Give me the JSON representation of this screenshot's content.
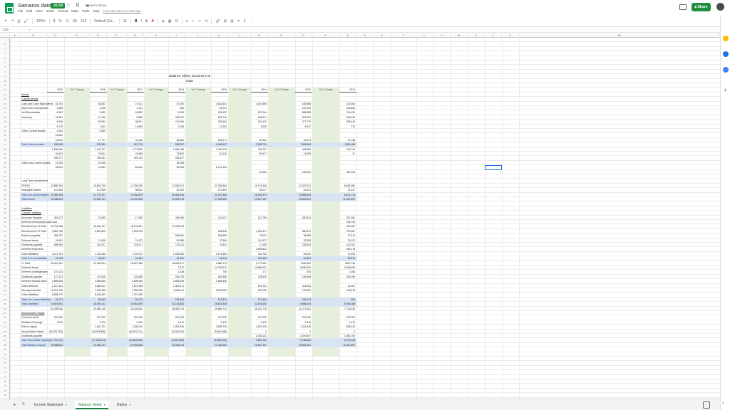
{
  "app": {
    "doc_title": "Samaroo data-3",
    "file_badge": ".XLSX",
    "save_status": "Saved to Drive",
    "share_label": "Share",
    "menu": [
      "File",
      "Edit",
      "View",
      "Insert",
      "Format",
      "Data",
      "Tools",
      "Help"
    ],
    "last_edit": "Last edit was seconds ago"
  },
  "toolbar": {
    "zoom": "100%",
    "currency": "$",
    "percent": "%",
    "dec_less": ".0",
    "dec_more": ".00",
    "more_formats": "123",
    "font": "Default (Ca...",
    "font_size": "11",
    "bold": "B",
    "italic": "I",
    "strike": "S",
    "text_color": "A"
  },
  "formula_bar": {
    "cell_ref": "Z29",
    "fx": "fx"
  },
  "colors": {
    "brand": "#0f9d58",
    "share": "#1e8e3e",
    "yoy_fill": "#e6efdc",
    "total_fill": "#d9e4f3",
    "selection": "#1a73e8"
  },
  "columns": [
    "A",
    "B",
    "C",
    "D",
    "E",
    "F",
    "G",
    "H",
    "I",
    "J",
    "K",
    "L",
    "M",
    "N",
    "O",
    "P",
    "Q",
    "R",
    "S",
    "T",
    "U",
    "V",
    "W",
    "X",
    "Y",
    "Z",
    "AA"
  ],
  "sheet": {
    "title_line1": "Balance Sheet, amounts in $",
    "title_line2": "Data",
    "year_headers": [
      "2019",
      "2018",
      "2017",
      "2016",
      "2015",
      "2014",
      "2013",
      "2012"
    ],
    "yoy_header": "YoY Change",
    "labels": [
      "Assets",
      "Current Assets",
      "Cash and Cash Equivalents",
      "Short Term Investments",
      "Net Receivables",
      "Inventory",
      "",
      "",
      "Other Current Assets",
      "",
      "",
      "Total Current Assets",
      "",
      "",
      "",
      "Other non-Current assets",
      "",
      "",
      "",
      "Long Term Investments",
      "PPE&E",
      "Intangible Assets",
      "Total non-current assets",
      "Total Assets",
      "",
      "Liabilities",
      "Current Liabilities",
      "Accounts Payable",
      "Deferred revenue/pre-paid cost",
      "Short/Current LT Debt",
      "Short/Current LT Debt",
      "Salaries payable",
      "Deferred taxes",
      "Dividends payable",
      "Deferred expenses",
      "Other liabilities",
      "Total Current Liabilities",
      "LT Debt",
      "Deferred taxes",
      "Deferred contingencies",
      "Dividends payable",
      "Deferred federal taxes",
      "Other deferred",
      "Minority interests",
      "Other liabilities",
      "Total non-current liabilities",
      "Total Liabilities",
      "",
      "Stockholders' Equity",
      "Common stock",
      "Retained Earnings",
      "Paid-in equity",
      "Accumulated losses",
      "Dividends payable",
      "Total Stockholder Equity",
      "Total liability & Equity"
    ],
    "rows": [
      [
        "",
        "",
        "",
        "",
        "",
        "",
        "",
        ""
      ],
      [
        "",
        "",
        "",
        "",
        "",
        "",
        "",
        ""
      ],
      [
        "15,792",
        "53,532",
        "27,472",
        "37,052",
        "1,632,601",
        "3,357,659",
        "425,858",
        "152,052"
      ],
      [
        "2,506",
        "1,918",
        "1,121",
        "350",
        "92,021",
        "",
        "137,916",
        "403,825"
      ],
      [
        "6,502",
        "5,083",
        "15,852",
        "9,296",
        "190,657",
        "637,264",
        "858,985",
        "744,422"
      ],
      [
        "14,367",
        "14,166",
        "8,885",
        "328,257",
        "594,716",
        "489,671",
        "307,532",
        "249,029"
      ],
      [
        "6,026",
        "30,554",
        "35,874",
        "112,564",
        "249,664",
        "222,475",
        "277,775",
        "254,649"
      ],
      [
        "5,175",
        "1,511",
        "11,656",
        "2,165",
        "12,282",
        "3,905",
        "4,937",
        "776"
      ],
      [
        "3,104",
        "5,655",
        "",
        "",
        "",
        "",
        "",
        ""
      ],
      [
        "14,652",
        "",
        "",
        "",
        "",
        "",
        "",
        ""
      ],
      [
        "15,576",
        "17,777",
        "50,116",
        "26,681",
        "153,071",
        "50,342",
        "31,573",
        "37,138"
      ],
      [
        "159,628",
        "203,994",
        "213,776",
        "596,397",
        "4,066,907",
        "3,359,724",
        "2065,548",
        "2991,488"
      ],
      [
        "1,506,165",
        "1,343,707",
        "1,773,509",
        "1,854,788",
        "1,430,178",
        "726,737",
        "405,580",
        "246,724"
      ],
      [
        "76,423",
        "76,621",
        "76,688",
        "76,802",
        "49,120",
        "59,477",
        "11,699",
        "47"
      ],
      [
        "269,717",
        "399,611",
        "349,134",
        "424,627",
        "",
        "",
        "",
        ""
      ],
      [
        "10,035",
        "10,035",
        "",
        "39,458",
        "",
        "",
        "",
        ""
      ],
      [
        "16,031",
        "14,063",
        "62,522",
        "69,005",
        "2,473,103",
        "",
        "",
        ""
      ],
      [
        "",
        "",
        "",
        "",
        "",
        "16,963",
        "152,512",
        "387,903"
      ],
      [
        "",
        "",
        "",
        "",
        "",
        "",
        "",
        ""
      ],
      [
        "",
        "",
        "",
        "",
        "",
        "",
        "",
        ""
      ],
      [
        "12,850,263",
        "16,834,725",
        "17,755,209",
        "17,653,912",
        "21,305,363",
        "16,176,436",
        "12,437,031",
        "8,626,080"
      ],
      [
        "121,505",
        "121,505",
        "96,822",
        "90,242",
        "121,505",
        "93,027",
        "22,531",
        "31,427"
      ],
      [
        "15,334,185",
        "22,776,127",
        "19,936,829",
        "19,463,346",
        "24,337,456",
        "16,043,373",
        "12,886,546",
        "8,671,713"
      ],
      [
        "15,488,813",
        "22,980,121",
        "20,150,555",
        "20,059,215",
        "27,425,460",
        "19,557,187",
        "15,651,601",
        "11,501,857"
      ],
      [
        "",
        "",
        "",
        "",
        "",
        "",
        "",
        ""
      ],
      [
        "",
        "",
        "",
        "",
        "",
        "",
        "",
        ""
      ],
      [
        "",
        "",
        "",
        "",
        "",
        "",
        "",
        ""
      ],
      [
        "253,172",
        "78,455",
        "47,455",
        "265,056",
        "116,127",
        "347,765",
        "350,514",
        "257,061"
      ],
      [
        "",
        "",
        "",
        "",
        "",
        "",
        "",
        "256,799"
      ],
      [
        "20,733,158",
        "18,340,127",
        "15,176,051",
        "17,378,515",
        "",
        "",
        "",
        "416,287"
      ],
      [
        "2,831,706",
        "1,822,819",
        "1,303,275",
        "",
        "228,545",
        "1,281,571",
        "550,679",
        "270,287"
      ],
      [
        "266,737",
        "",
        "",
        "599,681",
        "186,589",
        "76,001",
        "58,986",
        "27,314"
      ],
      [
        "16,492",
        "21,818",
        "21,473",
        "50,988",
        "37,396",
        "110,927",
        "32,928",
        "75,122"
      ],
      [
        "655,609",
        "263,227",
        "278,071",
        "178,211",
        "74,524",
        "12,408",
        "235,518",
        "112,201"
      ],
      [
        "",
        "",
        "",
        "",
        "",
        "1,509,833",
        "",
        "646,278"
      ],
      [
        "4,271,701",
        "1,763,435",
        "1,725,011",
        "1,526,050",
        "1,973,353",
        "332,752",
        "53,942",
        "12,905"
      ],
      [
        "44,735",
        "36,527",
        "10,361",
        "34,261",
        "26,243",
        "163,154",
        "19,652",
        "28,574"
      ],
      [
        "28,110,161",
        "22,332,024",
        "18,187,455",
        "15,833,317",
        "2,680,175",
        "3,773,332",
        "2280,662",
        "2320,745"
      ],
      [
        "",
        "",
        "",
        "7,572",
        "14,745,912",
        "10,595,031",
        "6,080,651",
        "6,045,890"
      ],
      [
        "127,123",
        "",
        "",
        "1,148",
        "748",
        "177",
        "478",
        "1,355"
      ],
      [
        "127,123",
        "115,526",
        "125,455",
        "246,729",
        "150,565",
        "128,678",
        "145,569",
        "339,396"
      ],
      [
        "2,805,545",
        "2,805,545",
        "2,805,545",
        "2,805,545",
        "2,805,545",
        "",
        "",
        ""
      ],
      [
        "2,047,161",
        "2,085,014",
        "1,907,305",
        "1,300,471",
        "",
        "513,743",
        "413,603",
        "22,057"
      ],
      [
        "12,074,736",
        "7,293,995",
        "7,255,925",
        "4,006,474",
        "5,951,032",
        "387,045",
        "179,492",
        "136,518"
      ],
      [
        "5,556,279",
        "5,425,435",
        "1,757,428",
        "",
        "",
        "",
        "",
        ""
      ],
      [
        "45,774",
        "89,063",
        "69,233",
        "794,440",
        "176,379",
        "172,454",
        "169,124",
        "590"
      ],
      [
        "24,897,891",
        "19,594,111",
        "16,943,099",
        "21,153,862",
        "26,616,348",
        "11,876,440",
        "8,985,678",
        "5,936,188"
      ],
      [
        "52,498,056",
        "40,986,135",
        "35,135,554",
        "36,982,019",
        "29,896,723",
        "25,315,775",
        "11,273,402",
        "7,726,939"
      ]
    ],
    "rows_equity": [
      [
        "297,025",
        "297,025",
        "297,025",
        "297,025",
        "297,025",
        "297,025",
        "297,025",
        "297,025"
      ],
      [
        "2,476",
        "2,476",
        "2,476",
        "2,476",
        "2,476",
        "2,476",
        "2,476",
        "2,476"
      ],
      [
        "",
        "1,622,721",
        "1,009,240",
        "1,552,404",
        "3,539,225",
        "1,615,125",
        "1,116,425",
        "695,243"
      ],
      [
        "(30,262,782)",
        "(19,003,898)",
        "(16,591,741)",
        "(9,903,811)",
        "(5,541,988)",
        "0",
        "0",
        "0"
      ],
      [
        "",
        "",
        "",
        "",
        "",
        "2,034,161",
        "2,049,547",
        "1,854,755"
      ],
      [
        "(37,075,241)",
        "(17,116,614)",
        "(14,602,605)",
        "(6,822,806)",
        "(1,853,264)",
        "4,615,762",
        "3,758,643",
        "5,274,128"
      ],
      [
        "15,488,813",
        "22,980,121",
        "20,156,555",
        "20,059,215",
        "27,425,460",
        "19,557,187",
        "15,651,601",
        "11,501,857"
      ]
    ]
  },
  "tabs": [
    {
      "label": "Income Statement"
    },
    {
      "label": "Balance Sheet"
    },
    {
      "label": "Ratios"
    }
  ]
}
